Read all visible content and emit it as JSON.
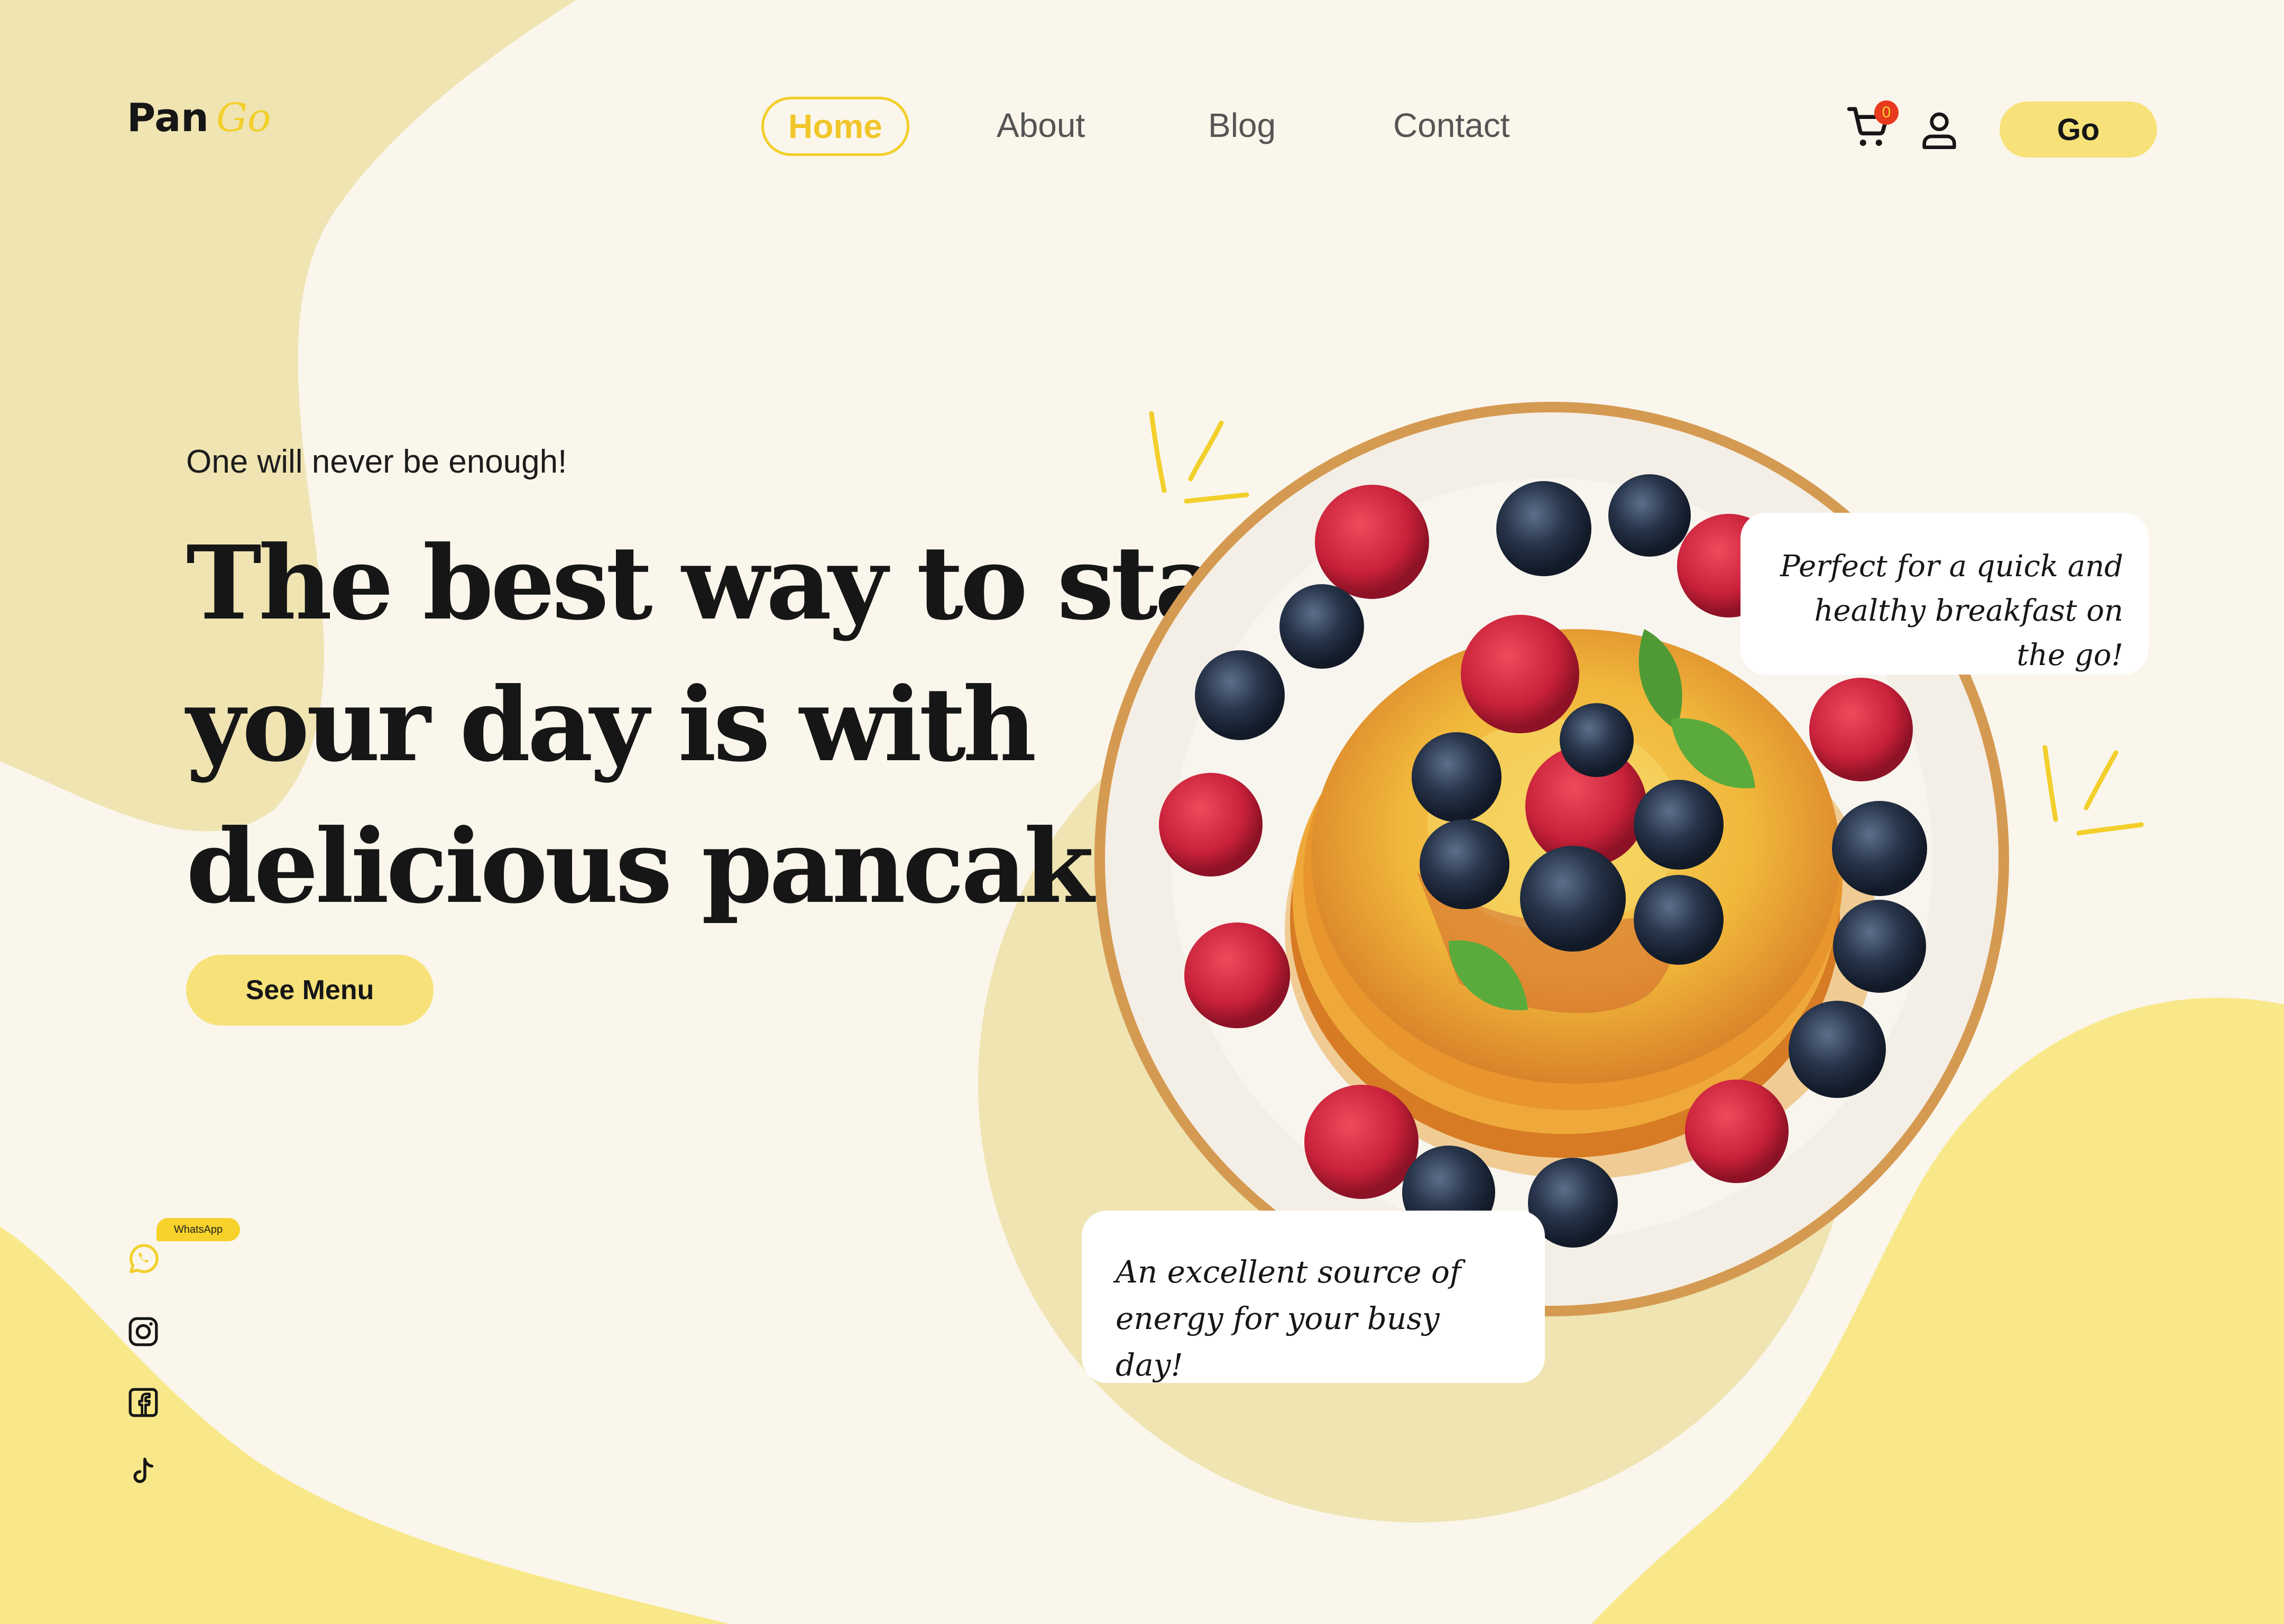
{
  "brand": {
    "name_part1": "Pan",
    "name_part2": "Go"
  },
  "nav": {
    "home": "Home",
    "about": "About",
    "blog": "Blog",
    "contact": "Contact"
  },
  "header": {
    "cart_count": "0",
    "go_button": "Go",
    "icons": [
      "cart-icon",
      "user-icon"
    ]
  },
  "hero": {
    "subtitle": "One will never be enough!",
    "headline": "The best way to start your day is with delicious pancakes",
    "cta": "See Menu"
  },
  "callouts": {
    "top": "Perfect for a quick and healthy breakfast on the go!",
    "bottom": "An excellent source of energy for your busy day!"
  },
  "social": {
    "whatsapp_tag": "WhatsApp",
    "icons": [
      "whatsapp-icon",
      "instagram-icon",
      "facebook-icon",
      "tiktok-icon"
    ]
  },
  "colors": {
    "accent": "#f7d22b",
    "button": "#f7e27a",
    "blob": "#efe4b2",
    "background": "#faf6ec",
    "text": "#161616"
  }
}
